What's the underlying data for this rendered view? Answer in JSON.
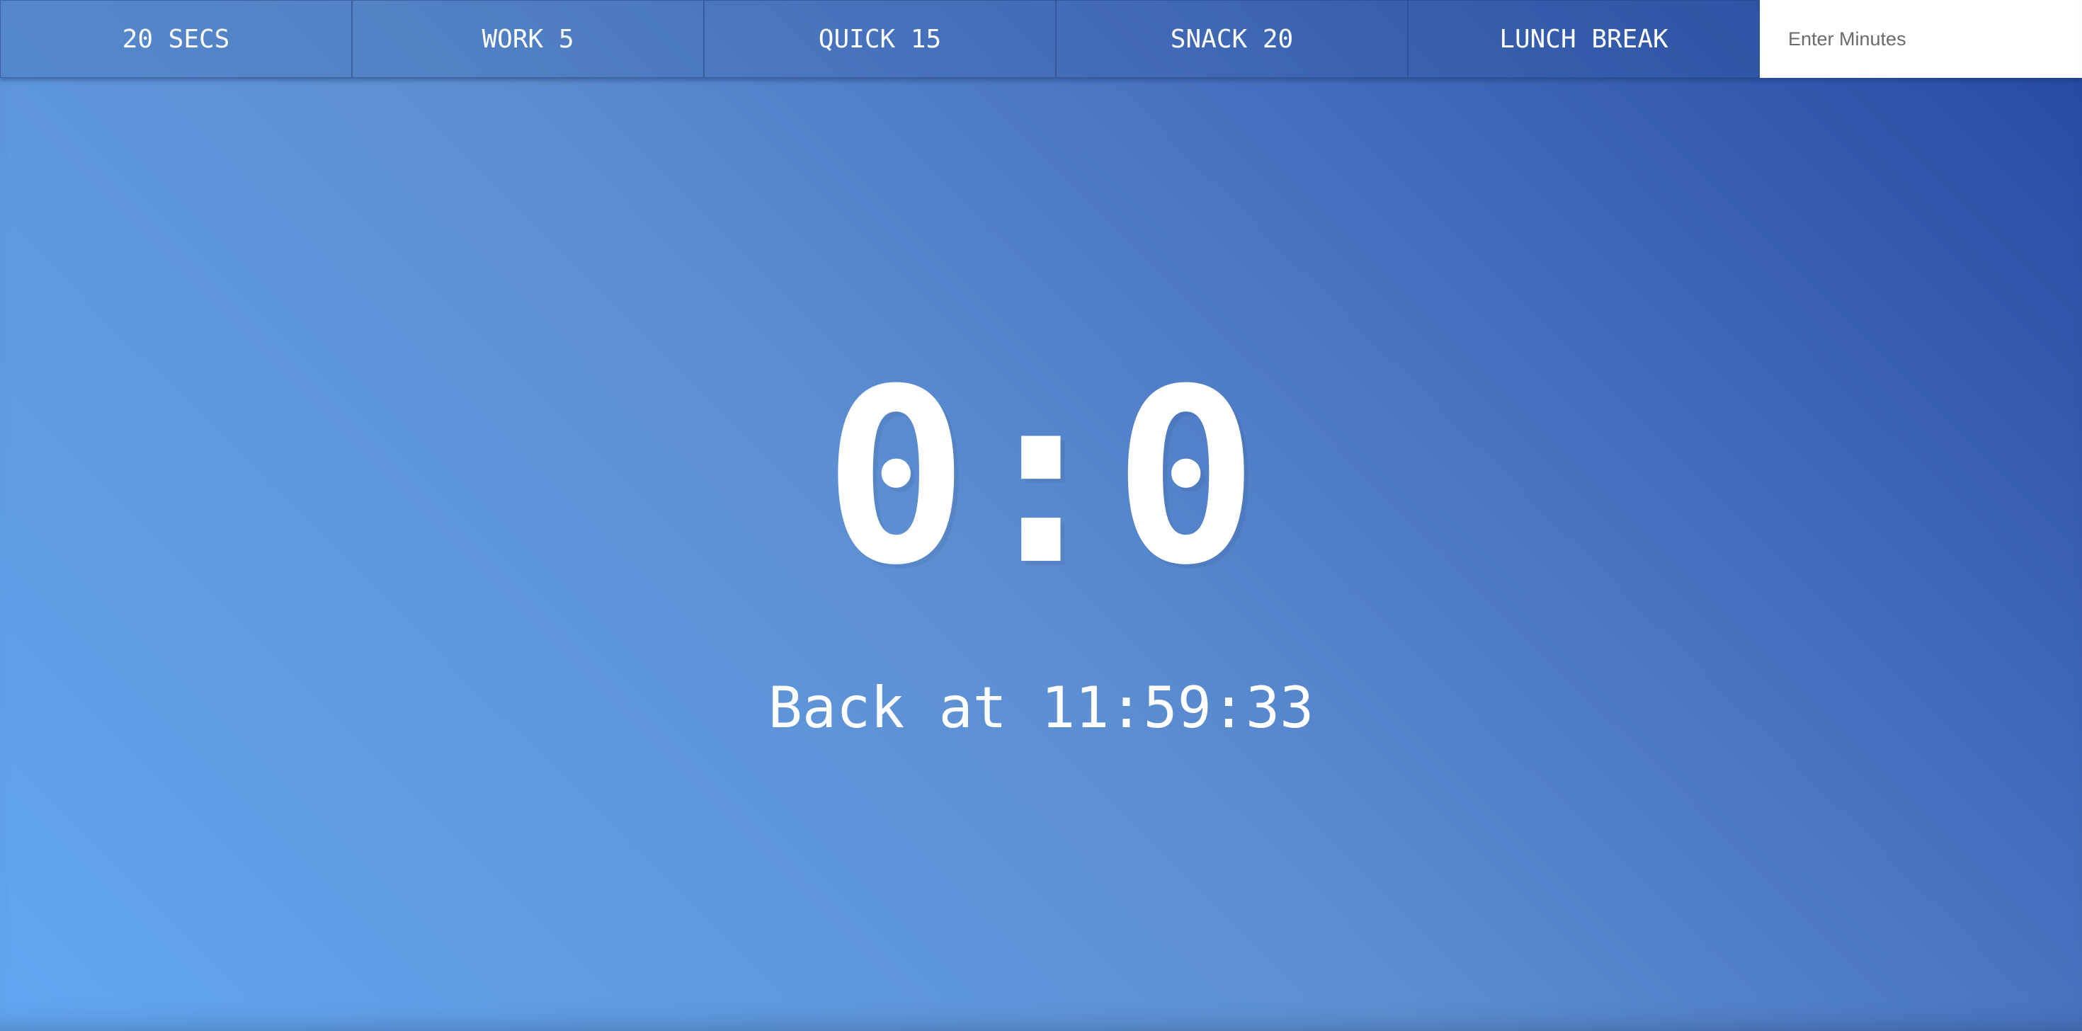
{
  "presets": [
    {
      "label": "20 SECS"
    },
    {
      "label": "WORK 5"
    },
    {
      "label": "QUICK 15"
    },
    {
      "label": "SNACK 20"
    },
    {
      "label": "LUNCH BREAK"
    }
  ],
  "minutes_input": {
    "placeholder": "Enter Minutes",
    "value": ""
  },
  "display": {
    "time_left": "0:0",
    "end_time": "Back at 11:59:33"
  },
  "colors": {
    "gradient_start": "#62a6f1",
    "gradient_end": "#2548a0",
    "text": "#ffffff"
  }
}
